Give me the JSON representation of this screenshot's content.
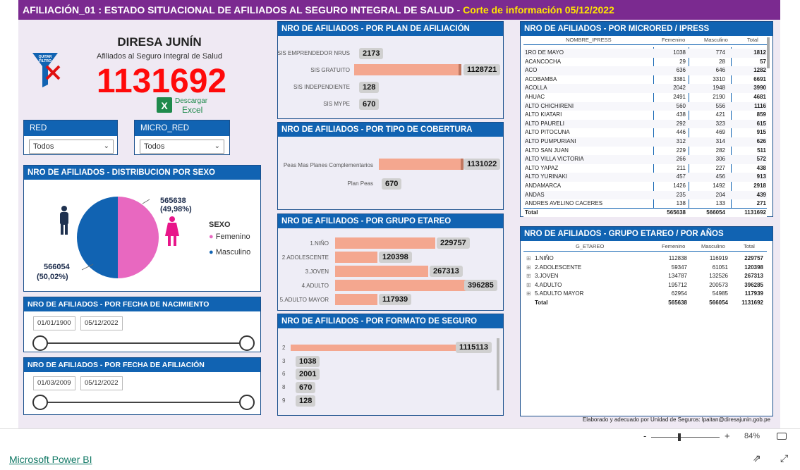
{
  "banner": {
    "title": "AFILIACIÓN_01 : ESTADO SITUACIONAL DE AFILIADOS AL SEGURO INTEGRAL DE SALUD",
    "sep": " - ",
    "cut": "Corte de información 05/12/2022"
  },
  "header": {
    "org": "DIRESA JUNÍN",
    "subtitle": "Afiliados al Seguro Integral de Salud",
    "total": "1131692",
    "filter_icon_text": "QUITAR FILTRO",
    "excel_line1": "Descargar",
    "excel_line2": "Excel"
  },
  "slicers": {
    "red": {
      "title": "RED",
      "value": "Todos"
    },
    "micro": {
      "title": "MICRO_RED",
      "value": "Todos"
    }
  },
  "sexo": {
    "title": "NRO DE AFILIADOS - DISTRIBUCION POR SEXO",
    "fem_value": "565638",
    "fem_pct": "(49,98%)",
    "mas_value": "566054",
    "mas_pct": "(50,02%)",
    "legend_title": "SEXO",
    "legend_fem": "Femenino",
    "legend_mas": "Masculino",
    "color_fem": "#e868c0",
    "color_mas": "#1163b2"
  },
  "nac": {
    "title": "NRO DE AFILIADOS - POR FECHA DE NACIMIENTO",
    "from": "01/01/1900",
    "to": "05/12/2022"
  },
  "afil": {
    "title": "NRO DE AFILIADOS - POR FECHA DE AFILIACIÓN",
    "from": "01/03/2009",
    "to": "05/12/2022"
  },
  "plan": {
    "title": "NRO DE AFILIADOS - POR PLAN DE AFILIACIÓN",
    "rows": [
      {
        "label": "SIS EMPRENDEDOR NRUS",
        "value": "2173"
      },
      {
        "label": "SIS GRATUITO",
        "value": "1128721"
      },
      {
        "label": "SIS INDEPENDIENTE",
        "value": "128"
      },
      {
        "label": "SIS MYPE",
        "value": "670"
      }
    ]
  },
  "cob": {
    "title": "NRO DE AFILIADOS - POR TIPO DE COBERTURA",
    "rows": [
      {
        "label": "Peas Mas Planes Complementarios",
        "value": "1131022"
      },
      {
        "label": "Plan Peas",
        "value": "670"
      }
    ]
  },
  "etareo": {
    "title": "NRO DE AFILIADOS - POR GRUPO ETAREO",
    "rows": [
      {
        "label": "1.NIÑO",
        "value": "229757"
      },
      {
        "label": "2.ADOLESCENTE",
        "value": "120398"
      },
      {
        "label": "3.JOVEN",
        "value": "267313"
      },
      {
        "label": "4.ADULTO",
        "value": "396285"
      },
      {
        "label": "5.ADULTO MAYOR",
        "value": "117939"
      }
    ]
  },
  "formato": {
    "title": "NRO DE AFILIADOS - POR FORMATO DE SEGURO",
    "rows": [
      {
        "label": "2",
        "value": "1115113"
      },
      {
        "label": "3",
        "value": "1038"
      },
      {
        "label": "6",
        "value": "2001"
      },
      {
        "label": "8",
        "value": "670"
      },
      {
        "label": "9",
        "value": "128"
      }
    ]
  },
  "micro": {
    "title": "NRO DE AFILIADOS - POR MICRORED / IPRESS",
    "cols": [
      "NOMBRE_IPRESS",
      "Femenino",
      "Masculino",
      "Total"
    ],
    "rows": [
      [
        "1RO DE MAYO",
        "1038",
        "774",
        "1812"
      ],
      [
        "ACANCOCHA",
        "29",
        "28",
        "57"
      ],
      [
        "ACO",
        "636",
        "646",
        "1282"
      ],
      [
        "ACOBAMBA",
        "3381",
        "3310",
        "6691"
      ],
      [
        "ACOLLA",
        "2042",
        "1948",
        "3990"
      ],
      [
        "AHUAC",
        "2491",
        "2190",
        "4681"
      ],
      [
        "ALTO CHICHIRENI",
        "560",
        "556",
        "1116"
      ],
      [
        "ALTO KIATARI",
        "438",
        "421",
        "859"
      ],
      [
        "ALTO PAURELI",
        "292",
        "323",
        "615"
      ],
      [
        "ALTO PITOCUNA",
        "446",
        "469",
        "915"
      ],
      [
        "ALTO PUMPURIANI",
        "312",
        "314",
        "626"
      ],
      [
        "ALTO SAN JUAN",
        "229",
        "282",
        "511"
      ],
      [
        "ALTO VILLA VICTORIA",
        "266",
        "306",
        "572"
      ],
      [
        "ALTO YAPAZ",
        "211",
        "227",
        "438"
      ],
      [
        "ALTO YURINAKI",
        "457",
        "456",
        "913"
      ],
      [
        "ANDAMARCA",
        "1426",
        "1492",
        "2918"
      ],
      [
        "ANDAS",
        "235",
        "204",
        "439"
      ],
      [
        "ANDRES AVELINO CACERES",
        "138",
        "133",
        "271"
      ]
    ],
    "total": [
      "Total",
      "565638",
      "566054",
      "1131692"
    ]
  },
  "edades": {
    "title": "NRO DE AFILIADOS - GRUPO ETAREO / POR AÑOS",
    "cols": [
      "G_ETAREO",
      "Femenino",
      "Masculino",
      "Total"
    ],
    "rows": [
      [
        "1.NIÑO",
        "112838",
        "116919",
        "229757"
      ],
      [
        "2.ADOLESCENTE",
        "59347",
        "61051",
        "120398"
      ],
      [
        "3.JOVEN",
        "134787",
        "132526",
        "267313"
      ],
      [
        "4.ADULTO",
        "195712",
        "200573",
        "396285"
      ],
      [
        "5.ADULTO MAYOR",
        "62954",
        "54985",
        "117939"
      ]
    ],
    "total": [
      "Total",
      "565638",
      "566054",
      "1131692"
    ]
  },
  "credit": "Elaborado y adecuado por  Unidad de Seguros: lpaitan@diresajunin.gob.pe",
  "footer": {
    "brand": "Microsoft Power BI",
    "zoom": "84%",
    "minus": "-",
    "plus": "+"
  }
}
